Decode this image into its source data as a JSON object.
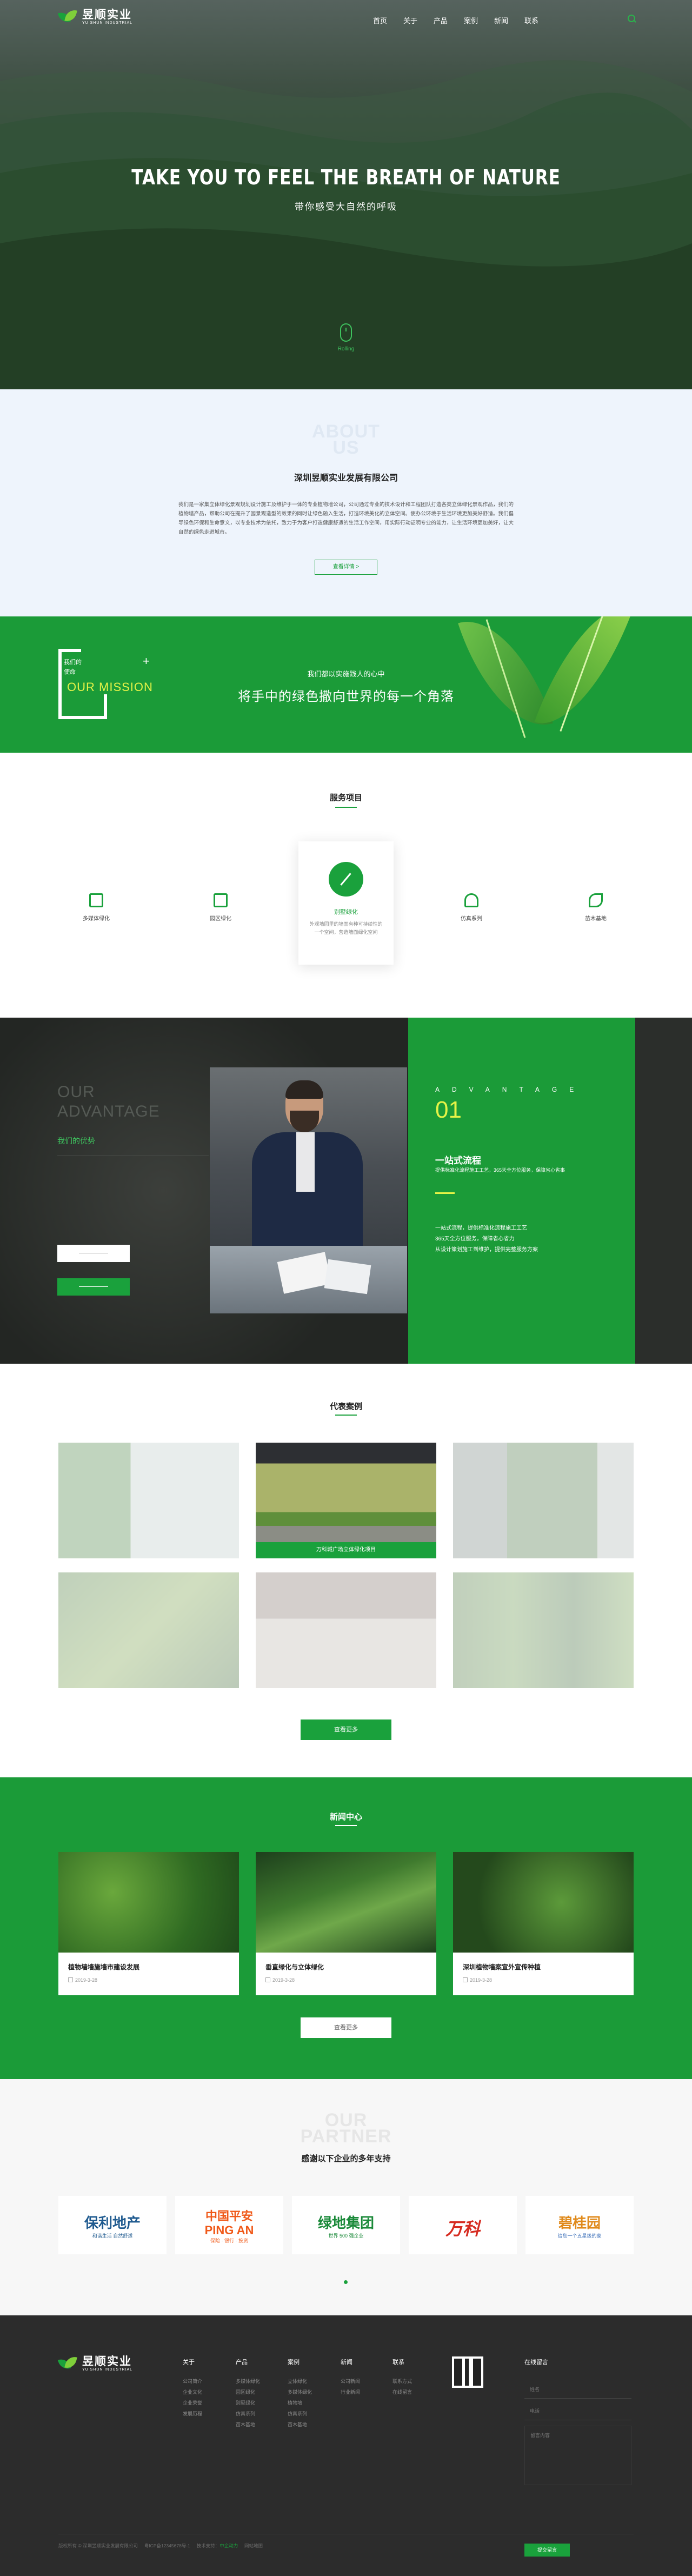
{
  "brand": {
    "name_cn": "昱顺实业",
    "name_en": "YU SHUN INDUSTRIAL"
  },
  "nav": {
    "items": [
      "首页",
      "关于",
      "产品",
      "案例",
      "新闻",
      "联系"
    ],
    "search_icon": "search-icon",
    "accent": "#2bb24c"
  },
  "hero": {
    "title": "TAKE YOU TO FEEL THE BREATH OF NATURE",
    "subtitle": "带你感受大自然的呼吸",
    "scroll_label": "Rolling"
  },
  "about": {
    "ghost1": "ABOUT",
    "ghost2": "US",
    "title": "深圳昱顺实业发展有限公司",
    "text": "我们是一家集立体绿化景观规划设计施工及维护于一体的专业植物墙公司，公司通过专业的技术设计和工程团队打造各类立体绿化景观作品，我们的植物墙产品，帮助公司在提升了园景观造型的效果的同时让绿色融入生活，打造环境美化的立体空间。使办公环境于生活环境更加美好舒适。我们倡导绿色环保和生命意义，以专业技术为依托，致力于为客户打造健康舒适的生活工作空间，用实际行动证明专业的能力，让生活环境更加美好，让大自然的绿色走进城市。",
    "more": "查看详情 >"
  },
  "mission": {
    "label_line1": "我们的",
    "label_line2": "使命",
    "en": "OUR MISSION",
    "plus": "+",
    "sub": "我们都以实施践人的心中",
    "main": "将手中的绿色撒向世界的每一个角落"
  },
  "services": {
    "title": "服务项目",
    "items": [
      {
        "label": "多媒体绿化",
        "icon": "monitor-icon"
      },
      {
        "label": "园区绿化",
        "icon": "shop-icon"
      },
      {
        "label": "别墅绿化",
        "icon": "pen-icon",
        "desc": "外观墙园里的墙面有种可持续性的一个空间，营造墙面绿化空间"
      },
      {
        "label": "仿真系列",
        "icon": "stamp-icon"
      },
      {
        "label": "苗木基地",
        "icon": "sprout-icon"
      }
    ]
  },
  "advantage": {
    "en_line1": "OUR",
    "en_line2": "ADVANTAGE",
    "cn": "我们的优势",
    "spaced": "ADVANTAGE",
    "num": "01",
    "heading": "一站式流程",
    "heading_sub": "提供标准化流程施工工艺，365天全方位服务，保障省心省事",
    "list": [
      "一站式流程，提供标准化流程施工工艺",
      "365天全方位服务，保障省心省力",
      "从设计策划施工到维护，提供完整服务方案"
    ]
  },
  "cases": {
    "title": "代表案例",
    "caption": "万科城广场立体绿化项目",
    "more": "查看更多"
  },
  "news": {
    "title": "新闻中心",
    "items": [
      {
        "title": "植物墙墙施墙市建设发展",
        "date": "2019-3-28"
      },
      {
        "title": "垂直绿化与立体绿化",
        "date": "2019-3-28"
      },
      {
        "title": "深圳植物墙案宣外宣传种植",
        "date": "2019-3-28"
      }
    ],
    "more": "查看更多"
  },
  "partner": {
    "ghost1": "OUR",
    "ghost2": "PARTNER",
    "title": "感谢以下企业的多年支持",
    "logos": [
      {
        "name": "保利地产",
        "sub": "和谐生活  自然舒适",
        "color": "#1f5a8f"
      },
      {
        "name": "中国平安",
        "en": "PING AN",
        "sub": "保险 · 银行 · 投资",
        "color": "#f05a1a"
      },
      {
        "name": "绿地集团",
        "sub": "世界 500 强企业",
        "color": "#1b8a3a"
      },
      {
        "name": "万科",
        "color": "#d62b20"
      },
      {
        "name": "碧桂园",
        "sub": "给您一个五星级的家",
        "color": "#e08a1b"
      }
    ]
  },
  "footer": {
    "cols": [
      {
        "head": "关于",
        "items": [
          "公司简介",
          "企业文化",
          "企业荣誉",
          "发展历程"
        ]
      },
      {
        "head": "产品",
        "items": [
          "多媒体绿化",
          "园区绿化",
          "别墅绿化",
          "仿真系列",
          "苗木基地"
        ]
      },
      {
        "head": "案例",
        "items": [
          "立体绿化",
          "多媒体绿化",
          "植物墙",
          "仿真系列",
          "苗木基地"
        ]
      },
      {
        "head": "新闻",
        "items": [
          "公司新闻",
          "行业新闻"
        ]
      },
      {
        "head": "联系",
        "items": [
          "联系方式",
          "在线留言"
        ]
      }
    ],
    "msg_head": "在线留言",
    "name_ph": "姓名",
    "phone_ph": "电话",
    "content_ph": "留言内容",
    "submit": "提交留言",
    "copyright": "版权所有 © 深圳昱顺实业发展有限公司",
    "icp": "粤ICP备12345678号-1",
    "tech": "技术支持：",
    "tech_link": "中企动力",
    "site": "网站地图"
  }
}
